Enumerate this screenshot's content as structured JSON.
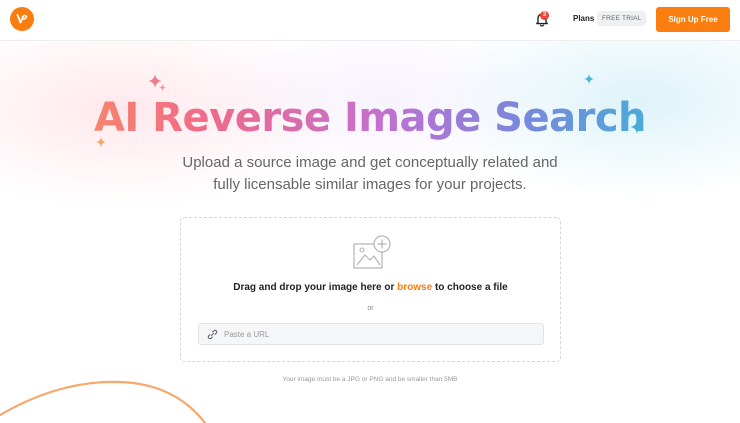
{
  "header": {
    "logo_icon": "vecteezy-logo-icon",
    "notification_count": "3",
    "plans_label": "Plans",
    "trial_badge": "FREE TRIAL",
    "signup_label": "Sign Up Free"
  },
  "hero": {
    "title": "AI Reverse Image Search",
    "subtitle_line1": "Upload a source image and get conceptually related and",
    "subtitle_line2": "fully licensable similar images for your projects."
  },
  "upload": {
    "drag_prefix": "Drag and drop your image here or ",
    "browse_label": "browse",
    "drag_suffix": " to choose a file",
    "or_label": "or",
    "url_placeholder": "Paste a URL",
    "url_value": "",
    "note": "Your image must be a JPG or PNG and be smaller than 5MB"
  },
  "colors": {
    "accent": "#fa7d0f",
    "badge": "#e8453c"
  }
}
